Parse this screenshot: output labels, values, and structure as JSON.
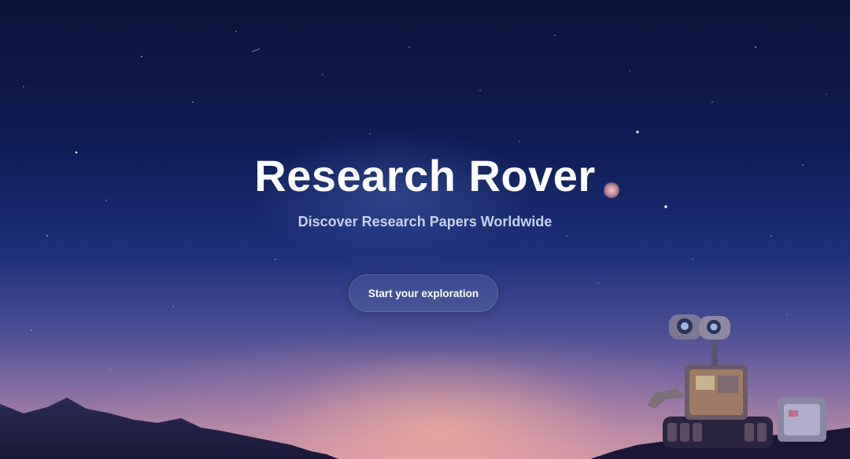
{
  "hero": {
    "title": "Research Rover",
    "subtitle": "Discover Research Papers Worldwide",
    "cta_label": "Start your exploration"
  },
  "colors": {
    "sky_top": "#0b1238",
    "sky_mid": "#1c3079",
    "horizon": "#c996a6",
    "title_text": "#ffffff",
    "subtitle_text": "#c7d3ef"
  },
  "decor": {
    "robot": "robot-illustration",
    "mountains": "mountain-silhouette",
    "stars": "starfield"
  }
}
